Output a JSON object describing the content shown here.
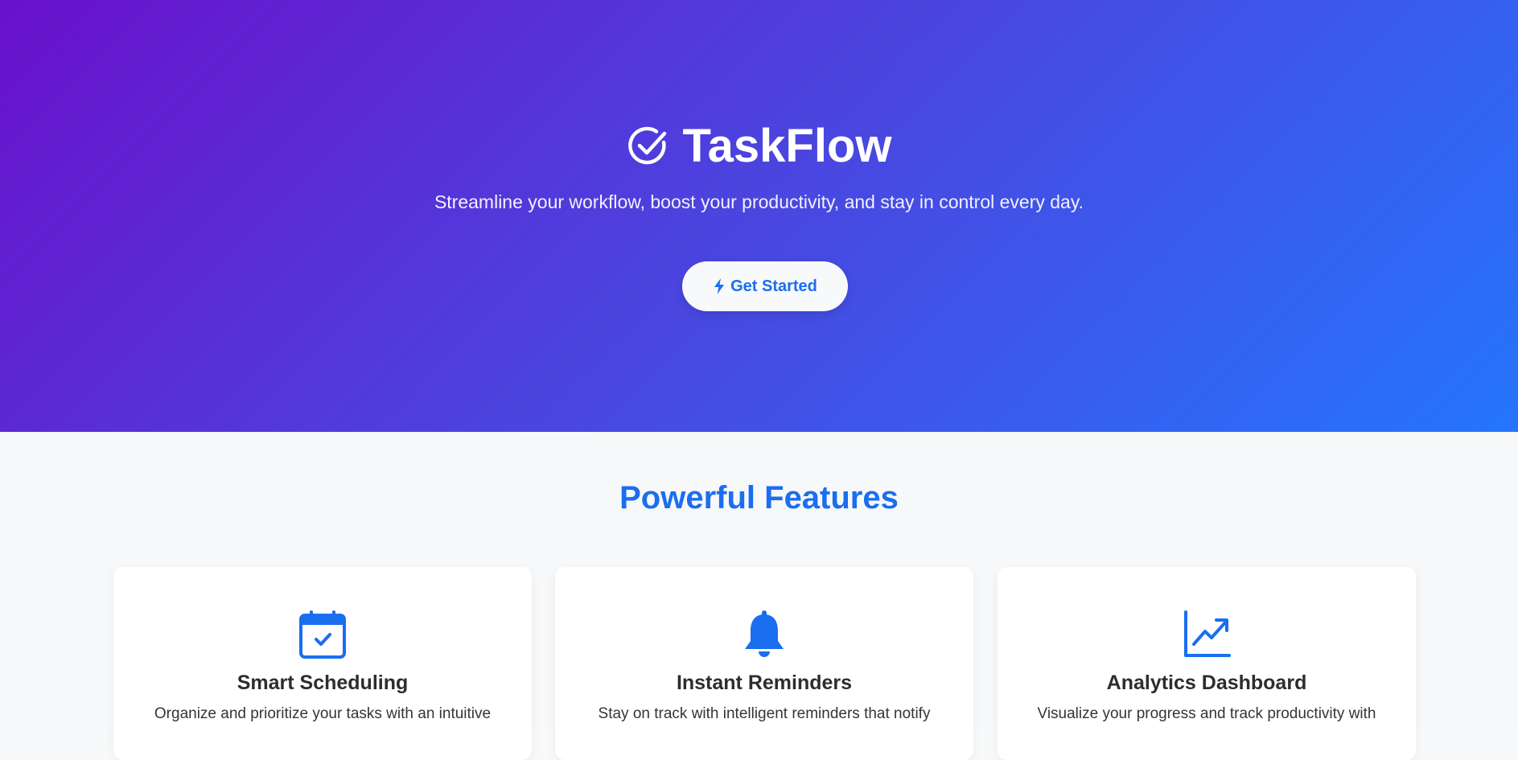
{
  "hero": {
    "title": "TaskFlow",
    "logo_icon": "check-circle-icon",
    "tagline": "Streamline your workflow, boost your productivity, and stay in control every day.",
    "cta_label": "Get Started",
    "cta_icon": "lightning-bolt-icon",
    "gradient_start": "#6a11cb",
    "gradient_end": "#2575fc"
  },
  "features": {
    "heading": "Powerful Features",
    "accent": "#1a6ef0",
    "cards": [
      {
        "icon": "calendar-check-icon",
        "title": "Smart Scheduling",
        "description": "Organize and prioritize your tasks with an intuitive"
      },
      {
        "icon": "bell-icon",
        "title": "Instant Reminders",
        "description": "Stay on track with intelligent reminders that notify"
      },
      {
        "icon": "chart-line-icon",
        "title": "Analytics Dashboard",
        "description": "Visualize your progress and track productivity with"
      }
    ]
  }
}
